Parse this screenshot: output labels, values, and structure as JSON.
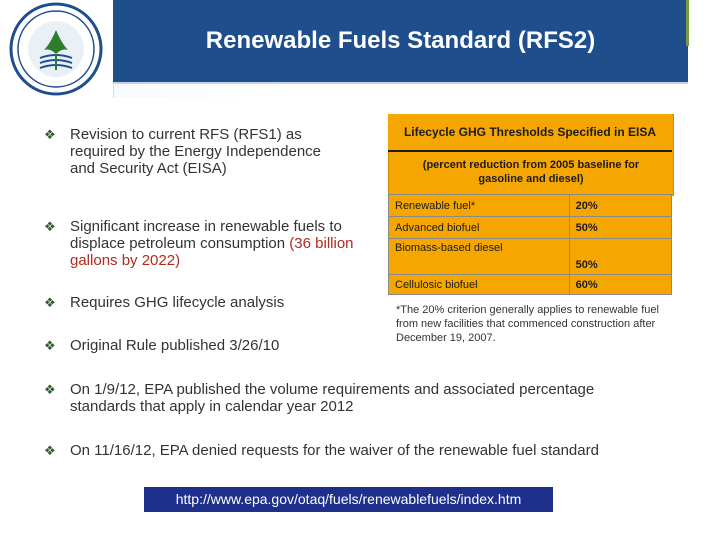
{
  "slide": {
    "title": "Renewable Fuels Standard (RFS2)",
    "seal_text": "UNITED STATES ENVIRONMENTAL PROTECTION AGENCY"
  },
  "bullets": [
    {
      "text": "Revision to current RFS (RFS1) as required by the Energy Independence and Security Act (EISA)"
    },
    {
      "text": "Significant increase in renewable fuels to displace petroleum consumption",
      "highlight": "(36 billion gallons by 2022)"
    },
    {
      "text": "Requires GHG lifecycle analysis"
    },
    {
      "text": "Original Rule published 3/26/10"
    },
    {
      "text": "On 1/9/12, EPA published the volume requirements and associated percentage standards that apply in calendar year 2012"
    },
    {
      "text": "On 11/16/12, EPA denied requests for the waiver of the renewable fuel standard"
    }
  ],
  "ghg_table": {
    "title": "Lifecycle GHG Thresholds Specified in EISA",
    "subtitle": "(percent reduction from 2005 baseline for gasoline and diesel)",
    "rows": [
      {
        "fuel": "Renewable fuel*",
        "value": "20%"
      },
      {
        "fuel": "Advanced biofuel",
        "value": "50%"
      },
      {
        "fuel": "Biomass-based diesel",
        "value": "50%"
      },
      {
        "fuel": "Cellulosic biofuel",
        "value": "60%"
      }
    ],
    "footnote": "*The 20% criterion generally applies to renewable fuel from new facilities that commenced construction after December 19, 2007."
  },
  "link": {
    "url": "http://www.epa.gov/otaq/fuels/renewablefuels/index.htm"
  },
  "colors": {
    "title_bar": "#1f4e8c",
    "table_fill": "#f5a600",
    "link_bar": "#1f2f8c",
    "highlight": "#b42a1e",
    "bullet": "#2b5c2b"
  }
}
